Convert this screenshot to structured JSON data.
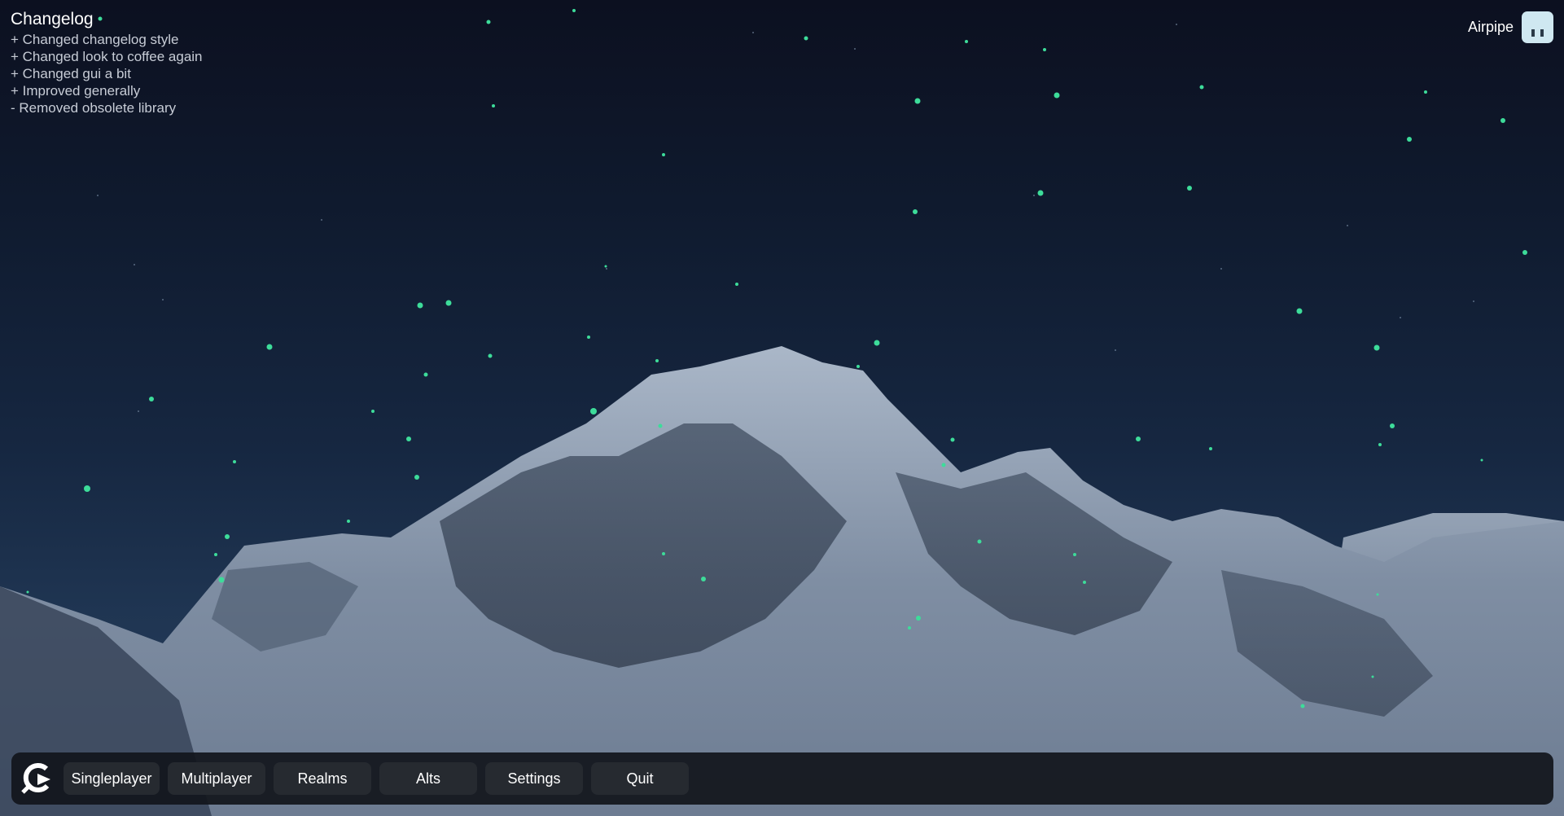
{
  "changelog": {
    "title": "Changelog",
    "entries": [
      "+ Changed changelog style",
      "+ Changed look to coffee again",
      "+ Changed gui a bit",
      "+ Improved generally",
      "- Removed obsolete library"
    ]
  },
  "account": {
    "username": "Airpipe",
    "avatar_icon": "player-head-icon"
  },
  "menu": {
    "logo_icon": "client-logo-icon",
    "buttons": [
      {
        "label": "Singleplayer"
      },
      {
        "label": "Multiplayer"
      },
      {
        "label": "Realms"
      },
      {
        "label": "Alts"
      },
      {
        "label": "Settings"
      },
      {
        "label": "Quit"
      }
    ]
  },
  "colors": {
    "particle": "#3ddc9a",
    "bar_background": "#12151c",
    "button_background": "#262a30"
  }
}
